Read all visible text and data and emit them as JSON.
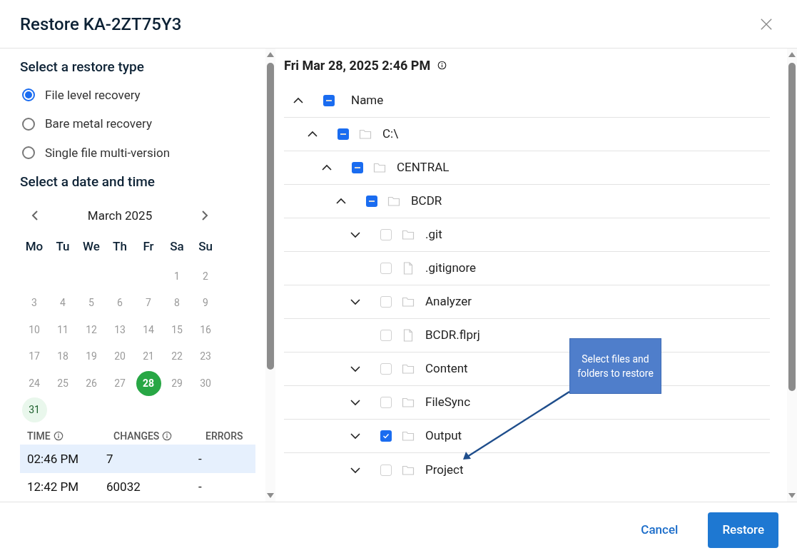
{
  "dialog": {
    "title": "Restore KA-2ZT75Y3"
  },
  "restore_type": {
    "heading": "Select a restore type",
    "options": [
      {
        "label": "File level recovery",
        "selected": true
      },
      {
        "label": "Bare metal recovery",
        "selected": false
      },
      {
        "label": "Single file multi-version",
        "selected": false
      }
    ]
  },
  "date_time": {
    "heading": "Select a date and time",
    "month": "March 2025",
    "weekdays": [
      "Mo",
      "Tu",
      "We",
      "Th",
      "Fr",
      "Sa",
      "Su"
    ],
    "weeks": [
      [
        {
          "day": "1",
          "selected": false,
          "today": false
        },
        {
          "day": "2",
          "selected": false,
          "today": false
        }
      ],
      [
        {
          "day": "3",
          "selected": false,
          "today": false
        },
        {
          "day": "4",
          "selected": false,
          "today": false
        },
        {
          "day": "5",
          "selected": false,
          "today": false
        },
        {
          "day": "6",
          "selected": false,
          "today": false
        },
        {
          "day": "7",
          "selected": false,
          "today": false
        },
        {
          "day": "8",
          "selected": false,
          "today": false
        },
        {
          "day": "9",
          "selected": false,
          "today": false
        }
      ],
      [
        {
          "day": "10",
          "selected": false,
          "today": false
        },
        {
          "day": "11",
          "selected": false,
          "today": false
        },
        {
          "day": "12",
          "selected": false,
          "today": false
        },
        {
          "day": "13",
          "selected": false,
          "today": false
        },
        {
          "day": "14",
          "selected": false,
          "today": false
        },
        {
          "day": "15",
          "selected": false,
          "today": false
        },
        {
          "day": "16",
          "selected": false,
          "today": false
        }
      ],
      [
        {
          "day": "17",
          "selected": false,
          "today": false
        },
        {
          "day": "18",
          "selected": false,
          "today": false
        },
        {
          "day": "19",
          "selected": false,
          "today": false
        },
        {
          "day": "20",
          "selected": false,
          "today": false
        },
        {
          "day": "21",
          "selected": false,
          "today": false
        },
        {
          "day": "22",
          "selected": false,
          "today": false
        },
        {
          "day": "23",
          "selected": false,
          "today": false
        }
      ],
      [
        {
          "day": "24",
          "selected": false,
          "today": false
        },
        {
          "day": "25",
          "selected": false,
          "today": false
        },
        {
          "day": "26",
          "selected": false,
          "today": false
        },
        {
          "day": "27",
          "selected": false,
          "today": false
        },
        {
          "day": "28",
          "selected": true,
          "today": false
        },
        {
          "day": "29",
          "selected": false,
          "today": false
        },
        {
          "day": "30",
          "selected": false,
          "today": false
        }
      ],
      [
        {
          "day": "31",
          "selected": false,
          "today": true
        }
      ]
    ]
  },
  "times": {
    "columns": [
      {
        "label": "TIME",
        "info": true
      },
      {
        "label": "CHANGES",
        "info": true
      },
      {
        "label": "ERRORS",
        "info": false
      }
    ],
    "rows": [
      {
        "cells": [
          "02:46 PM",
          "7",
          "-"
        ],
        "selected": true
      },
      {
        "cells": [
          "12:42 PM",
          "60032",
          "-"
        ],
        "selected": false
      }
    ]
  },
  "snapshot": {
    "title": "Fri Mar 28, 2025 2:46 PM"
  },
  "tree": [
    {
      "name": "Name",
      "kind": "header",
      "expanded": true,
      "checked": true,
      "partial": true,
      "children": [
        {
          "name": "C:\\",
          "kind": "folder",
          "expanded": true,
          "checked": true,
          "partial": true,
          "children": [
            {
              "name": "CENTRAL",
              "kind": "folder",
              "expanded": true,
              "checked": true,
              "partial": true,
              "children": [
                {
                  "name": "BCDR",
                  "kind": "folder",
                  "expanded": true,
                  "checked": true,
                  "partial": true,
                  "children": [
                    {
                      "name": ".git",
                      "kind": "folder",
                      "expanded": false,
                      "checked": false,
                      "partial": false
                    },
                    {
                      "name": ".gitignore",
                      "kind": "file",
                      "checked": false,
                      "partial": false
                    },
                    {
                      "name": "Analyzer",
                      "kind": "folder",
                      "expanded": false,
                      "checked": false,
                      "partial": false
                    },
                    {
                      "name": "BCDR.flprj",
                      "kind": "file",
                      "checked": false,
                      "partial": false
                    },
                    {
                      "name": "Content",
                      "kind": "folder",
                      "expanded": false,
                      "checked": false,
                      "partial": false
                    },
                    {
                      "name": "FileSync",
                      "kind": "folder",
                      "expanded": false,
                      "checked": false,
                      "partial": false
                    },
                    {
                      "name": "Output",
                      "kind": "folder",
                      "expanded": false,
                      "checked": true,
                      "partial": false
                    },
                    {
                      "name": "Project",
                      "kind": "folder",
                      "expanded": false,
                      "checked": false,
                      "partial": false
                    }
                  ]
                }
              ]
            }
          ]
        }
      ]
    }
  ],
  "callout": {
    "text": "Select files and folders to restore"
  },
  "buttons": {
    "cancel": "Cancel",
    "restore": "Restore"
  }
}
